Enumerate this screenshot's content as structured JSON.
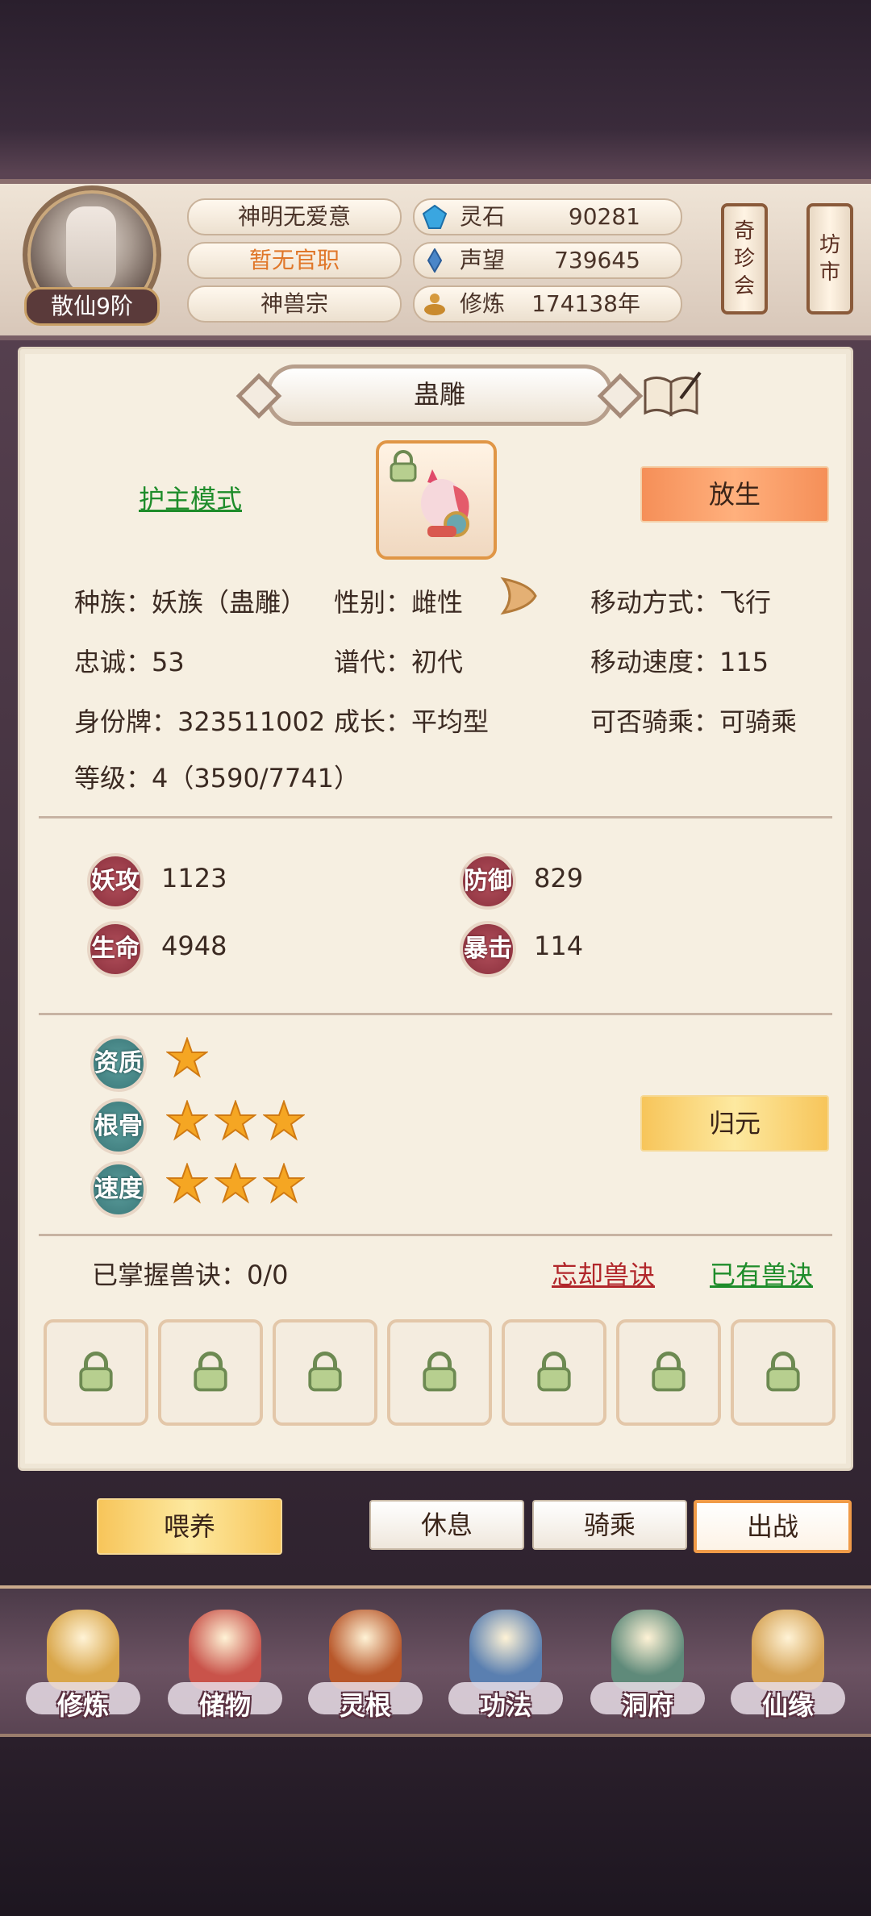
{
  "player": {
    "rank": "散仙9阶",
    "name": "神明无爱意",
    "official_title": "暂无官职",
    "sect": "神兽宗",
    "stats": [
      {
        "label": "灵石",
        "value": "90281",
        "icon": "spirit-stone-icon"
      },
      {
        "label": "声望",
        "value": "739645",
        "icon": "reputation-icon"
      },
      {
        "label": "修炼",
        "value": "174138年",
        "icon": "cultivation-icon"
      }
    ],
    "colors": {
      "title_orange": "#e0772a"
    }
  },
  "side_scrolls": [
    {
      "label": "奇珍会",
      "chars": [
        "奇",
        "珍",
        "会"
      ]
    },
    {
      "label": "坊市",
      "chars": [
        "坊",
        "市"
      ]
    }
  ],
  "pet": {
    "name": "蛊雕",
    "guard_mode_link": "护主模式",
    "release_button": "放生",
    "info": {
      "race": "种族：妖族（蛊雕）",
      "gender": "性别：雌性",
      "move_type": "移动方式：飞行",
      "loyalty": "忠诚：53",
      "generation": "谱代：初代",
      "move_speed": "移动速度：115",
      "id_card": "身份牌：323511002",
      "growth": "成长：平均型",
      "rideable": "可否骑乘：可骑乘",
      "level": "等级：4（3590/7741）"
    },
    "combat": [
      {
        "label": "妖攻",
        "value": "1123"
      },
      {
        "label": "防御",
        "value": "829"
      },
      {
        "label": "生命",
        "value": "4948"
      },
      {
        "label": "暴击",
        "value": "114"
      }
    ],
    "talents": [
      {
        "label": "资质",
        "stars": 1
      },
      {
        "label": "根骨",
        "stars": 3
      },
      {
        "label": "速度",
        "stars": 3
      }
    ],
    "reset_button": "归元",
    "skills_mastered": "已掌握兽诀：0/0",
    "forget_link": "忘却兽诀",
    "owned_link": "已有兽诀",
    "skill_slots": 7
  },
  "actions": {
    "feed": "喂养",
    "rest": "休息",
    "ride": "骑乘",
    "fight": "出战"
  },
  "nav": [
    {
      "label": "修炼",
      "icon": "cultivation-monk-icon",
      "color": "#d9a64a"
    },
    {
      "label": "储物",
      "icon": "storage-bag-icon",
      "color": "#c9534a"
    },
    {
      "label": "灵根",
      "icon": "spirit-root-icon",
      "color": "#b8572a"
    },
    {
      "label": "功法",
      "icon": "technique-book-icon",
      "color": "#5a7fb0"
    },
    {
      "label": "洞府",
      "icon": "cave-palace-icon",
      "color": "#5f8a7a"
    },
    {
      "label": "仙缘",
      "icon": "gourd-icon",
      "color": "#d5a254"
    }
  ]
}
